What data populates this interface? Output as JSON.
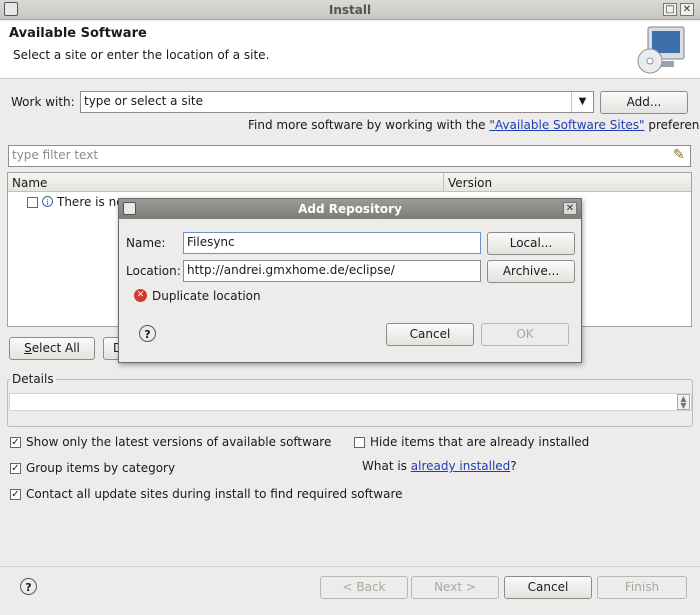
{
  "window": {
    "title": "Install"
  },
  "header": {
    "title": "Available Software",
    "subtitle": "Select a site or enter the location of a site.",
    "image_icon": "cd-monitor-icon"
  },
  "work_with": {
    "label": "Work with:",
    "placeholder": "type or select a site",
    "add_label": "Add...",
    "more_prefix": "Find more software by working with the ",
    "more_link": "\"Available Software Sites\"",
    "more_suffix": " preferences."
  },
  "filter": {
    "placeholder": "type filter text"
  },
  "table": {
    "columns": [
      "Name",
      "Version"
    ],
    "row_text": "There is no"
  },
  "buttons": {
    "select_all": "Select All",
    "deselect_partial": "D"
  },
  "details": {
    "label": "Details"
  },
  "options": {
    "latest": "Show only the latest versions of available software",
    "hide_installed": "Hide items that are already installed",
    "group": "Group items by category",
    "what_is_prefix": "What is ",
    "what_is_link": "already installed",
    "what_is_suffix": "?",
    "contact": "Contact all update sites during install to find required software"
  },
  "footer": {
    "back": "< Back",
    "next": "Next >",
    "cancel": "Cancel",
    "finish": "Finish"
  },
  "dialog": {
    "title": "Add Repository",
    "name_label": "Name:",
    "name_value": "Filesync",
    "local_label": "Local...",
    "location_label": "Location:",
    "location_value": "http://andrei.gmxhome.de/eclipse/",
    "archive_label": "Archive...",
    "error": "Duplicate location",
    "cancel": "Cancel",
    "ok": "OK"
  }
}
